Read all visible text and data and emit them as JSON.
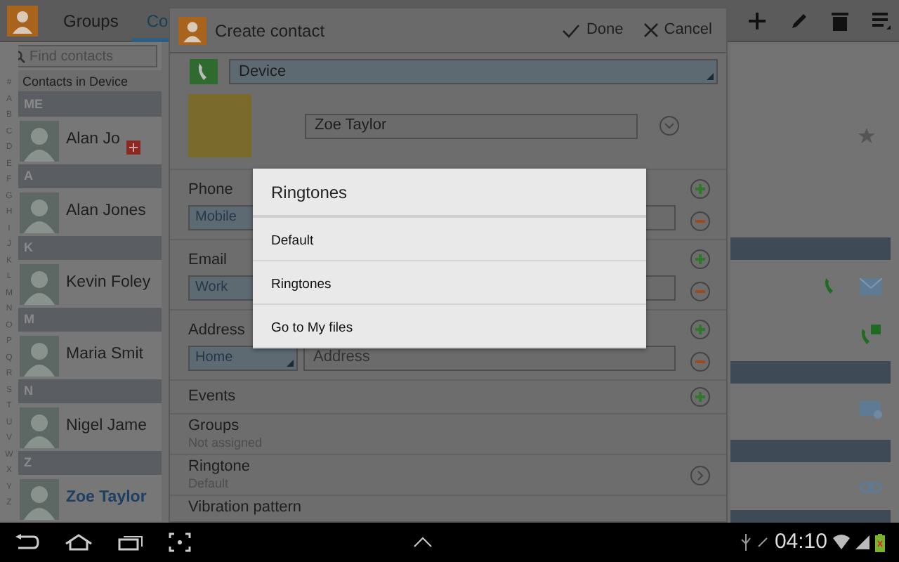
{
  "app_bar": {
    "tabs": [
      {
        "label": "Groups",
        "selected": false
      },
      {
        "label": "Co",
        "selected": true
      }
    ]
  },
  "search": {
    "placeholder": "Find contacts"
  },
  "list_header": "Contacts in Device",
  "index_letters": [
    "#",
    "A",
    "B",
    "C",
    "D",
    "E",
    "F",
    "G",
    "H",
    "I",
    "J",
    "K",
    "L",
    "M",
    "N",
    "O",
    "P",
    "Q",
    "R",
    "S",
    "T",
    "U",
    "V",
    "W",
    "X",
    "Y",
    "Z"
  ],
  "contact_groups": [
    {
      "header": "ME",
      "contacts": [
        {
          "name": "Alan Jo",
          "selected": false,
          "google_badge": true
        }
      ]
    },
    {
      "header": "A",
      "contacts": [
        {
          "name": "Alan Jones",
          "selected": false,
          "google_badge": false
        }
      ]
    },
    {
      "header": "K",
      "contacts": [
        {
          "name": "Kevin Foley",
          "selected": false,
          "google_badge": false
        }
      ]
    },
    {
      "header": "M",
      "contacts": [
        {
          "name": "Maria Smit",
          "selected": false,
          "google_badge": false
        }
      ]
    },
    {
      "header": "N",
      "contacts": [
        {
          "name": "Nigel Jame",
          "selected": false,
          "google_badge": false
        }
      ]
    },
    {
      "header": "Z",
      "contacts": [
        {
          "name": "Zoe Taylor",
          "selected": true,
          "google_badge": false
        }
      ]
    }
  ],
  "dialog": {
    "title": "Create contact",
    "done": "Done",
    "cancel": "Cancel",
    "account": "Device",
    "name": "Zoe Taylor",
    "sections": [
      {
        "kind": "typed",
        "label": "Phone",
        "type": "Mobile"
      },
      {
        "kind": "typed",
        "label": "Email",
        "type": "Work"
      },
      {
        "kind": "typed",
        "label": "Address",
        "type": "Home",
        "placeholder": "Address"
      },
      {
        "kind": "add",
        "label": "Events"
      },
      {
        "kind": "info",
        "label": "Groups",
        "sub": "Not assigned"
      },
      {
        "kind": "link",
        "label": "Ringtone",
        "sub": "Default"
      },
      {
        "kind": "info",
        "label": "Vibration pattern"
      }
    ]
  },
  "popup": {
    "title": "Ringtones",
    "options": [
      "Default",
      "Ringtones",
      "Go to My files"
    ]
  },
  "status_bar": {
    "time": "04:10"
  }
}
